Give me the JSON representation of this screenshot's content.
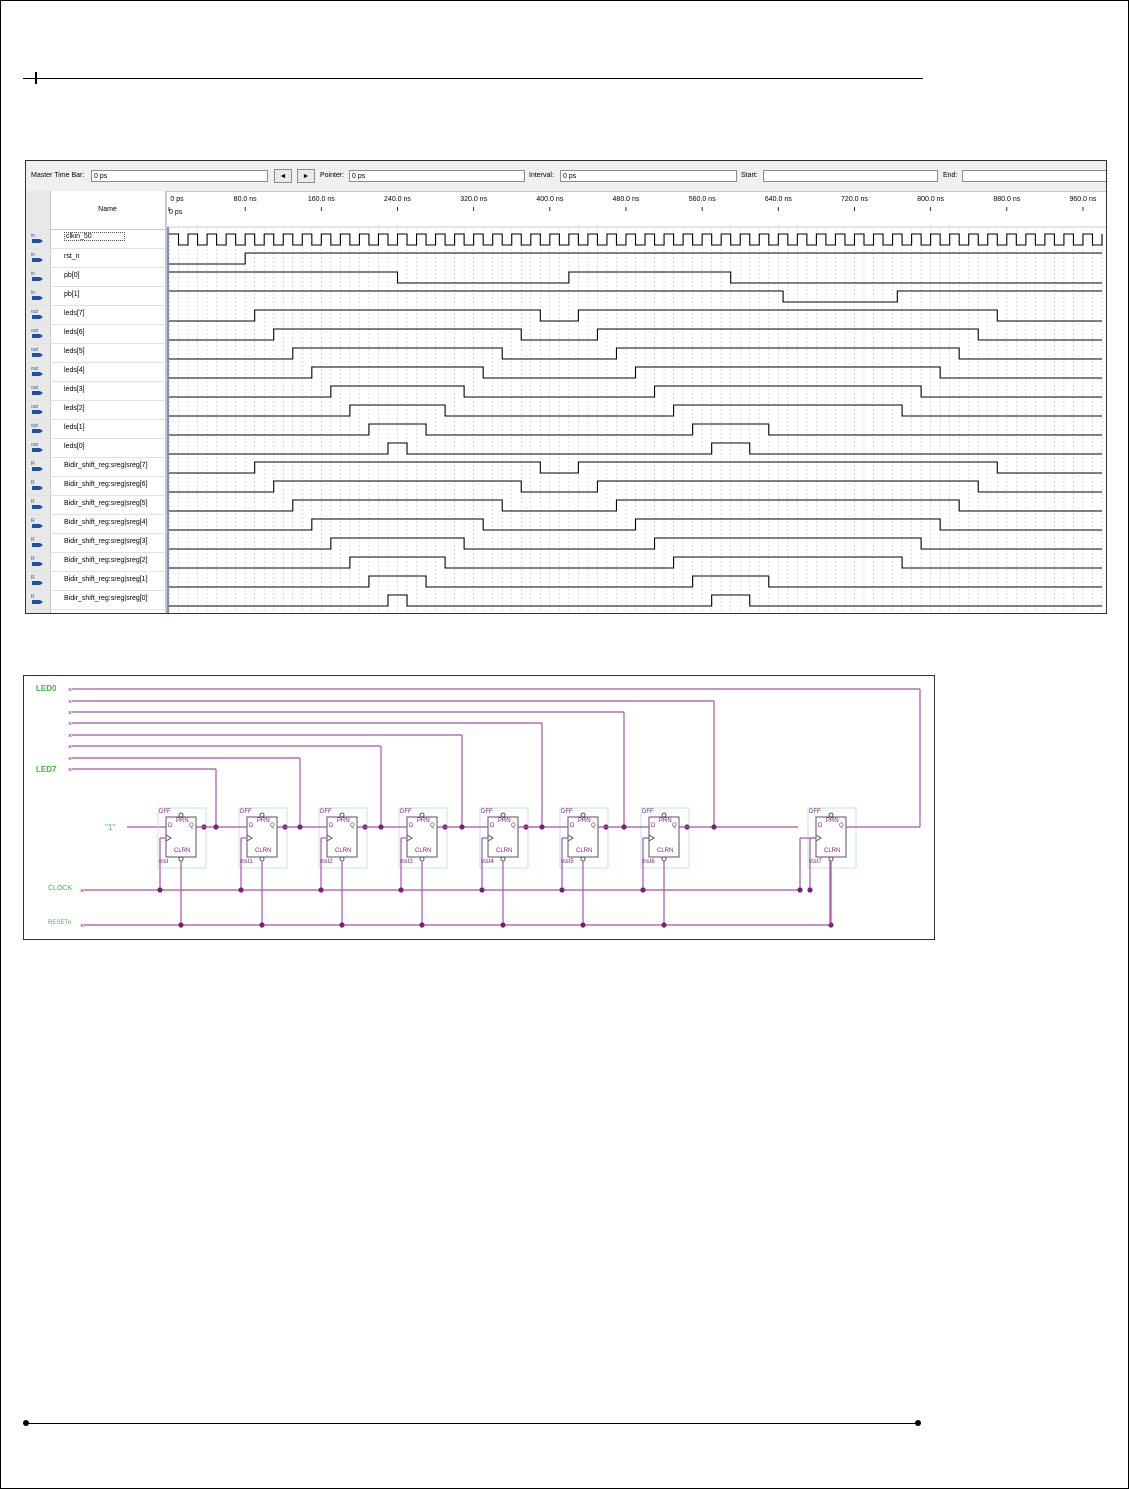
{
  "toolbar": {
    "master_time_bar_label": "Master Time Bar:",
    "master_time_bar_value": "0 ps",
    "prev_btn": "◄",
    "next_btn": "►",
    "pointer_label": "Pointer:",
    "pointer_value": "0 ps",
    "interval_label": "Interval:",
    "interval_value": "0 ps",
    "start_label": "Start:",
    "start_value": "",
    "end_label": "End:",
    "end_value": ""
  },
  "name_header": "Name",
  "time_axis": {
    "zero_label": "0 ps",
    "ticks": [
      "0 ps",
      "80.0 ns",
      "160.0 ns",
      "240.0 ns",
      "320.0 ns",
      "400.0 ns",
      "480.0 ns",
      "560.0 ns",
      "640.0 ns",
      "720.0 ns",
      "800.0 ns",
      "880.0 ns",
      "960.0 ns"
    ]
  },
  "signals": [
    {
      "name": "clkin_50",
      "dir": "in"
    },
    {
      "name": "rst_n",
      "dir": "in"
    },
    {
      "name": "pb[0]",
      "dir": "in"
    },
    {
      "name": "pb[1]",
      "dir": "in"
    },
    {
      "name": "leds[7]",
      "dir": "out"
    },
    {
      "name": "leds[6]",
      "dir": "out"
    },
    {
      "name": "leds[5]",
      "dir": "out"
    },
    {
      "name": "leds[4]",
      "dir": "out"
    },
    {
      "name": "leds[3]",
      "dir": "out"
    },
    {
      "name": "leds[2]",
      "dir": "out"
    },
    {
      "name": "leds[1]",
      "dir": "out"
    },
    {
      "name": "leds[0]",
      "dir": "out"
    },
    {
      "name": "Bidir_shift_reg:sreg|sreg[7]",
      "dir": "reg"
    },
    {
      "name": "Bidir_shift_reg:sreg|sreg[6]",
      "dir": "reg"
    },
    {
      "name": "Bidir_shift_reg:sreg|sreg[5]",
      "dir": "reg"
    },
    {
      "name": "Bidir_shift_reg:sreg|sreg[4]",
      "dir": "reg"
    },
    {
      "name": "Bidir_shift_reg:sreg|sreg[3]",
      "dir": "reg"
    },
    {
      "name": "Bidir_shift_reg:sreg|sreg[2]",
      "dir": "reg"
    },
    {
      "name": "Bidir_shift_reg:sreg|sreg[1]",
      "dir": "reg"
    },
    {
      "name": "Bidir_shift_reg:sreg|sreg[0]",
      "dir": "reg"
    }
  ],
  "waveforms": {
    "t_max_ns": 980,
    "clock_period_ns": 20,
    "levels": [
      {
        "init": 0,
        "edges": []
      },
      {
        "init": 0,
        "edges": [
          80
        ]
      },
      {
        "init": 1,
        "edges": [
          240,
          420,
          590
        ]
      },
      {
        "init": 1,
        "edges": [
          645,
          765
        ]
      },
      {
        "init": 0,
        "edges": [
          90,
          390,
          430,
          870
        ]
      },
      {
        "init": 0,
        "edges": [
          110,
          370,
          450,
          850
        ]
      },
      {
        "init": 0,
        "edges": [
          130,
          350,
          470,
          830
        ]
      },
      {
        "init": 0,
        "edges": [
          150,
          330,
          490,
          810
        ]
      },
      {
        "init": 0,
        "edges": [
          170,
          310,
          510,
          790
        ]
      },
      {
        "init": 0,
        "edges": [
          190,
          290,
          530,
          770
        ]
      },
      {
        "init": 0,
        "edges": [
          210,
          270,
          550,
          630
        ]
      },
      {
        "init": 0,
        "edges": [
          230,
          250,
          570,
          610
        ]
      },
      {
        "init": 0,
        "edges": [
          90,
          390,
          430,
          870
        ]
      },
      {
        "init": 0,
        "edges": [
          110,
          370,
          450,
          850
        ]
      },
      {
        "init": 0,
        "edges": [
          130,
          350,
          470,
          830
        ]
      },
      {
        "init": 0,
        "edges": [
          150,
          330,
          490,
          810
        ]
      },
      {
        "init": 0,
        "edges": [
          170,
          310,
          510,
          790
        ]
      },
      {
        "init": 0,
        "edges": [
          190,
          290,
          530,
          770
        ]
      },
      {
        "init": 0,
        "edges": [
          210,
          270,
          550,
          630
        ]
      },
      {
        "init": 0,
        "edges": [
          230,
          250,
          570,
          610
        ]
      }
    ]
  },
  "schematic": {
    "led_top": "LED0",
    "led_bottom": "LED7",
    "input_one": "\"1\"",
    "clock": "CLOCK",
    "reset": "RESETn",
    "ff_type": "DFF",
    "ff_pins": {
      "pre": "PRN",
      "q": "Q",
      "d": "D",
      "clr": "CLRN"
    },
    "ff_instances": [
      "inst",
      "inst1",
      "inst2",
      "inst3",
      "inst4",
      "inst5",
      "inst6",
      "inst7"
    ]
  },
  "colors": {
    "wire": "#a855a8",
    "junction": "#7a1f7a",
    "label_green": "#3fb93f",
    "ff_box": "#bfe6e6"
  }
}
